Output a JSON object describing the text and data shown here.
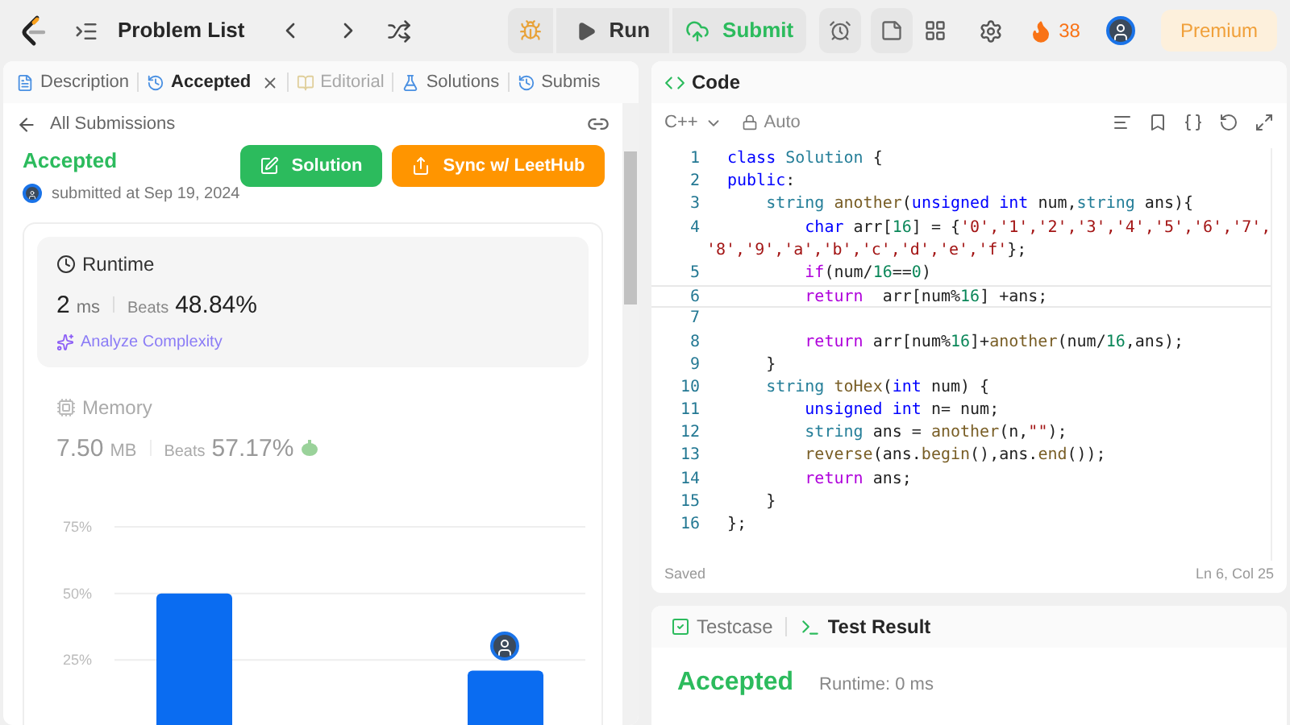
{
  "top_bar": {
    "nav_title": "Problem List",
    "run": "Run",
    "submit": "Submit",
    "streak": "38",
    "premium": "Premium"
  },
  "left_tabs": [
    {
      "label": "Description",
      "selected": false,
      "disabled": false,
      "closable": false
    },
    {
      "label": "Accepted",
      "selected": true,
      "disabled": false,
      "closable": true
    },
    {
      "label": "Editorial",
      "selected": false,
      "disabled": true,
      "closable": false
    },
    {
      "label": "Solutions",
      "selected": false,
      "disabled": false,
      "closable": false
    },
    {
      "label": "Submis",
      "selected": false,
      "disabled": false,
      "closable": false
    }
  ],
  "submission": {
    "back_link": "All Submissions",
    "status": "Accepted",
    "submitted": "submitted at Sep 19, 2024",
    "solution_button": "Solution",
    "sync_button": "Sync w/ LeetHub",
    "runtime": {
      "title": "Runtime",
      "value": "2",
      "unit": "ms",
      "beats_label": "Beats",
      "beats": "48.84%",
      "analyze": "Analyze Complexity"
    },
    "memory": {
      "title": "Memory",
      "value": "7.50",
      "unit": "MB",
      "beats_label": "Beats",
      "beats": "57.17%"
    },
    "chart_data": {
      "type": "bar",
      "values": [
        50,
        21
      ],
      "yticks": [
        {
          "value": 25,
          "label": "25%"
        },
        {
          "value": 50,
          "label": "50%"
        },
        {
          "value": 75,
          "label": "75%"
        }
      ],
      "ylim": [
        0,
        75
      ],
      "grid": true
    }
  },
  "code_panel": {
    "title": "Code",
    "language": "C++",
    "mode": "Auto",
    "saved": "Saved",
    "cursor": "Ln 6, Col 25",
    "lines": [
      {
        "number": "1",
        "current": false,
        "tokens": [
          {
            "kind": "kw",
            "text": "class "
          },
          {
            "kind": "type",
            "text": "Solution"
          },
          {
            "kind": "p",
            "text": " {"
          }
        ]
      },
      {
        "number": "2",
        "current": false,
        "tokens": [
          {
            "kind": "kw",
            "text": "public"
          },
          {
            "kind": "p",
            "text": ":"
          }
        ]
      },
      {
        "number": "3",
        "current": false,
        "tokens": [
          {
            "kind": "type",
            "text": "    string "
          },
          {
            "kind": "fn",
            "text": "another"
          },
          {
            "kind": "p",
            "text": "("
          },
          {
            "kind": "kw",
            "text": "unsigned int"
          },
          {
            "kind": "p",
            "text": " num,"
          },
          {
            "kind": "type",
            "text": "string"
          },
          {
            "kind": "p",
            "text": " ans){"
          }
        ]
      },
      {
        "number": "4",
        "current": false,
        "tokens": [
          {
            "kind": "kw",
            "text": "        char"
          },
          {
            "kind": "p",
            "text": " arr["
          },
          {
            "kind": "num",
            "text": "16"
          },
          {
            "kind": "p",
            "text": "] = {"
          },
          {
            "kind": "str",
            "text": "'0','1','2','3','4','5','6','7',"
          }
        ]
      },
      {
        "current": false,
        "tokens": [
          {
            "kind": "str",
            "text": "'8','9','a','b','c','d','e','f'"
          },
          {
            "kind": "p",
            "text": "};"
          }
        ]
      },
      {
        "number": "5",
        "current": false,
        "tokens": [
          {
            "kind": "ctl",
            "text": "        if"
          },
          {
            "kind": "p",
            "text": "(num/"
          },
          {
            "kind": "num",
            "text": "16"
          },
          {
            "kind": "p",
            "text": "=="
          },
          {
            "kind": "num",
            "text": "0"
          },
          {
            "kind": "p",
            "text": ")"
          }
        ]
      },
      {
        "number": "6",
        "current": true,
        "tokens": [
          {
            "kind": "ctl",
            "text": "        return"
          },
          {
            "kind": "p",
            "text": "  arr[num%"
          },
          {
            "kind": "num",
            "text": "16"
          },
          {
            "kind": "p",
            "text": "] +ans;"
          }
        ]
      },
      {
        "number": "7",
        "current": false
      },
      {
        "number": "8",
        "current": false,
        "tokens": [
          {
            "kind": "ctl",
            "text": "        return"
          },
          {
            "kind": "p",
            "text": " arr[num%"
          },
          {
            "kind": "num",
            "text": "16"
          },
          {
            "kind": "p",
            "text": "]+"
          },
          {
            "kind": "fn",
            "text": "another"
          },
          {
            "kind": "p",
            "text": "(num/"
          },
          {
            "kind": "num",
            "text": "16"
          },
          {
            "kind": "p",
            "text": ",ans);"
          }
        ]
      },
      {
        "number": "9",
        "current": false,
        "tokens": [
          {
            "kind": "p",
            "text": "    }"
          }
        ]
      },
      {
        "number": "10",
        "current": false,
        "tokens": [
          {
            "kind": "type",
            "text": "    string "
          },
          {
            "kind": "fn",
            "text": "toHex"
          },
          {
            "kind": "p",
            "text": "("
          },
          {
            "kind": "kw",
            "text": "int"
          },
          {
            "kind": "p",
            "text": " num) {"
          }
        ]
      },
      {
        "number": "11",
        "current": false,
        "tokens": [
          {
            "kind": "kw",
            "text": "        unsigned int"
          },
          {
            "kind": "p",
            "text": " n= num;"
          }
        ]
      },
      {
        "number": "12",
        "current": false,
        "tokens": [
          {
            "kind": "type",
            "text": "        string"
          },
          {
            "kind": "p",
            "text": " ans = "
          },
          {
            "kind": "fn",
            "text": "another"
          },
          {
            "kind": "p",
            "text": "(n,"
          },
          {
            "kind": "str",
            "text": "\"\""
          },
          {
            "kind": "p",
            "text": ");"
          }
        ]
      },
      {
        "number": "13",
        "current": false,
        "tokens": [
          {
            "kind": "fn",
            "text": "        reverse"
          },
          {
            "kind": "p",
            "text": "(ans."
          },
          {
            "kind": "fn",
            "text": "begin"
          },
          {
            "kind": "p",
            "text": "(),ans."
          },
          {
            "kind": "fn",
            "text": "end"
          },
          {
            "kind": "p",
            "text": "());"
          }
        ]
      },
      {
        "number": "14",
        "current": false,
        "tokens": [
          {
            "kind": "ctl",
            "text": "        return"
          },
          {
            "kind": "p",
            "text": " ans;"
          }
        ]
      },
      {
        "number": "15",
        "current": false,
        "tokens": [
          {
            "kind": "p",
            "text": "    }"
          }
        ]
      },
      {
        "number": "16",
        "current": false,
        "tokens": [
          {
            "kind": "p",
            "text": "};"
          }
        ]
      }
    ]
  },
  "result_panel": {
    "tabs": [
      {
        "label": "Testcase",
        "selected": false
      },
      {
        "label": "Test Result",
        "selected": true
      }
    ],
    "status": "Accepted",
    "runtime": "Runtime: 0 ms"
  }
}
